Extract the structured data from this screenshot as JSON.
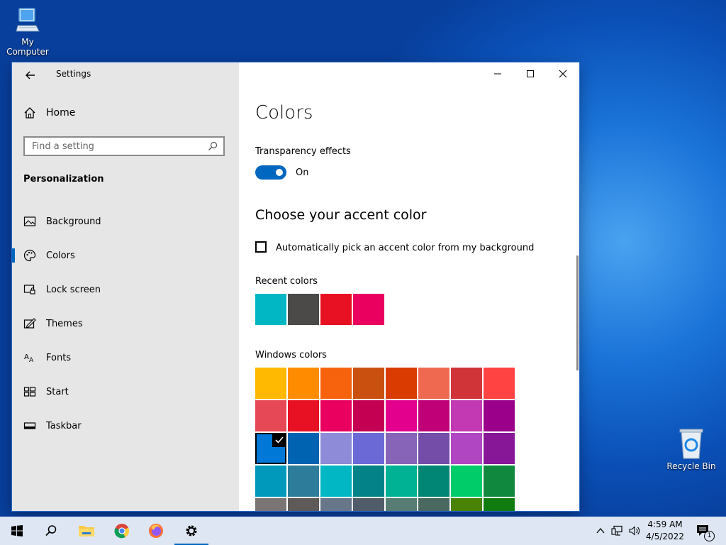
{
  "desktop": {
    "icons": [
      {
        "label": "My Computer"
      },
      {
        "label": "Recycle Bin"
      }
    ]
  },
  "window": {
    "title": "Settings",
    "sidebar": {
      "home_label": "Home",
      "search_placeholder": "Find a setting",
      "section_label": "Personalization",
      "items": [
        {
          "label": "Background",
          "icon": "image-icon"
        },
        {
          "label": "Colors",
          "icon": "palette-icon",
          "active": true
        },
        {
          "label": "Lock screen",
          "icon": "lock-screen-icon"
        },
        {
          "label": "Themes",
          "icon": "themes-icon"
        },
        {
          "label": "Fonts",
          "icon": "fonts-icon"
        },
        {
          "label": "Start",
          "icon": "start-icon"
        },
        {
          "label": "Taskbar",
          "icon": "taskbar-icon"
        }
      ]
    },
    "content": {
      "title": "Colors",
      "transparency_label": "Transparency effects",
      "transparency_state": "On",
      "accent_heading": "Choose your accent color",
      "auto_pick_label": "Automatically pick an accent color from my background",
      "recent_label": "Recent colors",
      "recent_colors": [
        "#00b7c3",
        "#4c4a48",
        "#e81123",
        "#ea005e"
      ],
      "windows_label": "Windows colors",
      "windows_colors": [
        "#ffb900",
        "#ff8c00",
        "#f7630c",
        "#ca5010",
        "#da3b01",
        "#ef6950",
        "#d13438",
        "#ff4343",
        "#e74856",
        "#e81123",
        "#ea005e",
        "#c30052",
        "#e3008c",
        "#bf0077",
        "#c239b3",
        "#9a0089",
        "#0078d7",
        "#0063b1",
        "#8e8cd8",
        "#6b69d6",
        "#8764b8",
        "#744da9",
        "#b146c2",
        "#881798",
        "#0099bc",
        "#2d7d9a",
        "#00b7c3",
        "#038387",
        "#00b294",
        "#018574",
        "#00cc6a",
        "#10893e",
        "#7a7574",
        "#5d5a58",
        "#68768a",
        "#515c6b",
        "#567c73",
        "#486860",
        "#498205",
        "#107c10"
      ],
      "selected_index": 16
    }
  },
  "taskbar": {
    "time": "4:59 AM",
    "date": "4/5/2022",
    "notification_count": "1"
  }
}
